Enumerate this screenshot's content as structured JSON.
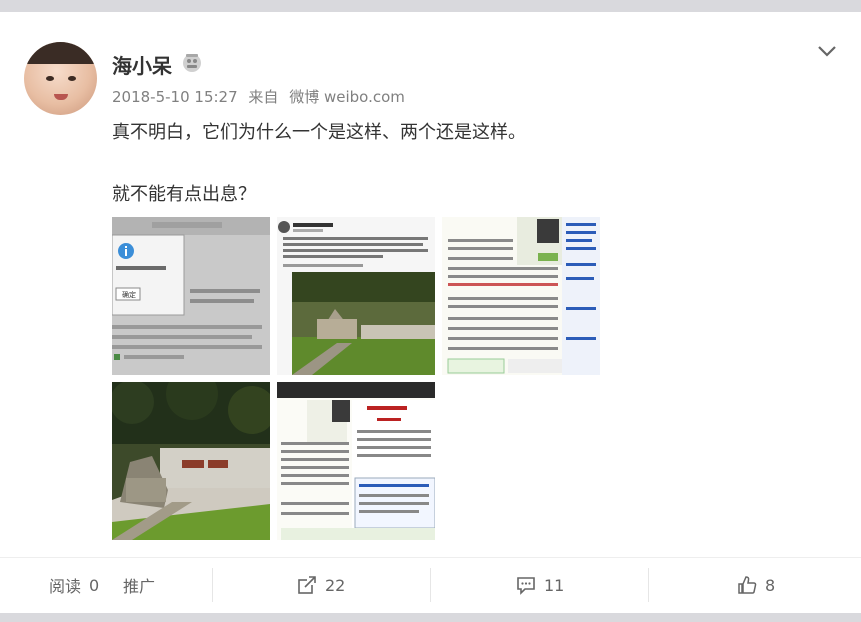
{
  "post": {
    "username": "海小呆",
    "timestamp": "2018-5-10 15:27",
    "source_prefix": "来自",
    "source": "微博 weibo.com",
    "text_line1": "真不明白，它们为什么一个是这样、两个还是这样。",
    "text_line2": "就不能有点出息？",
    "images": [
      {
        "thumb_dialog_confirm": "确定"
      }
    ]
  },
  "footer": {
    "read_label": "阅读",
    "read_count": "0",
    "promote_label": "推广",
    "repost_count": "22",
    "comment_count": "11",
    "like_count": "8"
  },
  "icons": {
    "vip": "vip-badge-icon",
    "menu": "chevron-down-icon",
    "repost": "share-icon",
    "comment": "comment-icon",
    "like": "thumbs-up-icon"
  },
  "colors": {
    "username": "#333333",
    "meta": "#808080",
    "footer_text": "#666666"
  }
}
